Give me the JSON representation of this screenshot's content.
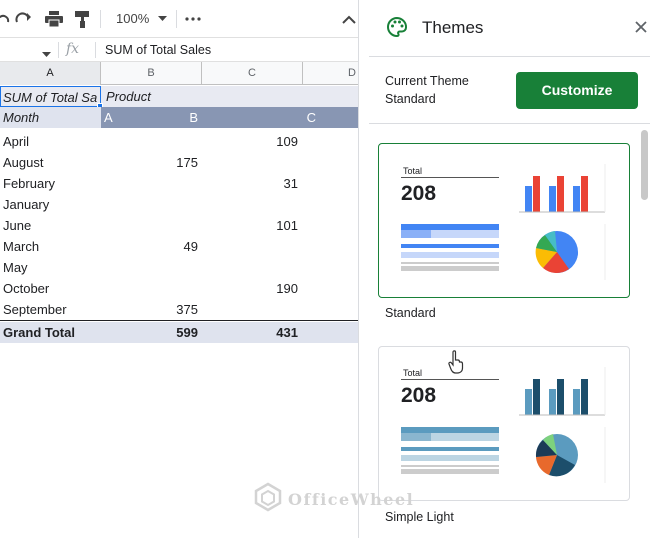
{
  "toolbar": {
    "zoom": "100%"
  },
  "formula_bar": {
    "fx": "fx",
    "formula": "SUM of Total Sales"
  },
  "columns": [
    "A",
    "B",
    "C",
    "D"
  ],
  "pivot": {
    "title_cell": "SUM of Total Sa",
    "title_cell_2": "Product",
    "header": {
      "label": "Month",
      "a": "A",
      "b": "B",
      "c": "C"
    },
    "rows": [
      {
        "month": "April",
        "b": "",
        "c": "109"
      },
      {
        "month": "August",
        "b": "175",
        "c": ""
      },
      {
        "month": "February",
        "b": "",
        "c": "31"
      },
      {
        "month": "January",
        "b": "",
        "c": ""
      },
      {
        "month": "June",
        "b": "",
        "c": "101"
      },
      {
        "month": "March",
        "b": "49",
        "c": ""
      },
      {
        "month": "May",
        "b": "",
        "c": ""
      },
      {
        "month": "October",
        "b": "",
        "c": "190"
      },
      {
        "month": "September",
        "b": "375",
        "c": ""
      }
    ],
    "total": {
      "label": "Grand Total",
      "b": "599",
      "c": "431"
    }
  },
  "panel": {
    "title": "Themes",
    "current_theme_label": "Current Theme",
    "current_theme_value": "Standard",
    "customize_label": "Customize",
    "themes": [
      {
        "name": "Standard",
        "preview_total_label": "Total",
        "preview_value": "208",
        "selected": true
      },
      {
        "name": "Simple Light",
        "preview_total_label": "Total",
        "preview_value": "208",
        "selected": false
      }
    ],
    "accent_color": "#188038"
  },
  "watermark": "OfficeWheel"
}
